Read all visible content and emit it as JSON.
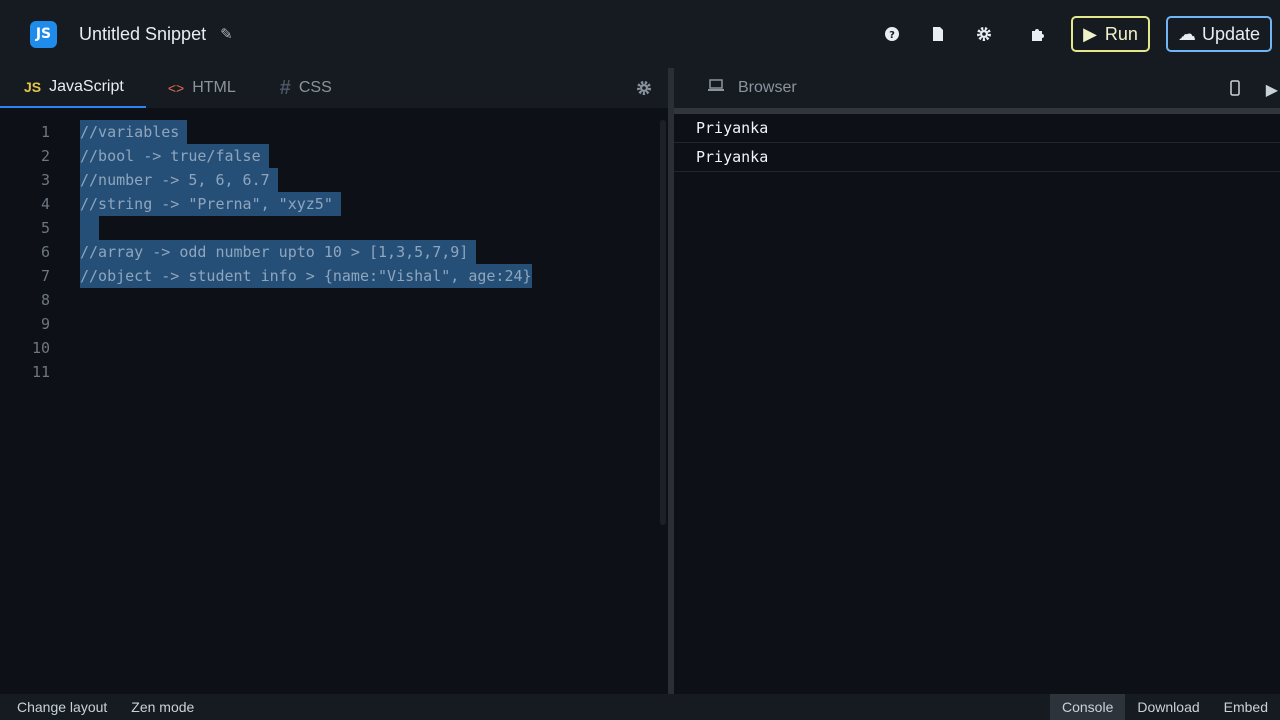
{
  "header": {
    "logo_text": "JS",
    "title": "Untitled Snippet",
    "run_label": "Run",
    "update_label": "Update"
  },
  "editor": {
    "tabs": [
      {
        "mark": "JS",
        "label": "JavaScript"
      },
      {
        "mark": "<>",
        "label": "HTML"
      },
      {
        "mark": "#",
        "label": "CSS"
      }
    ],
    "lines": [
      {
        "num": "1",
        "text": "//variables"
      },
      {
        "num": "2",
        "text": "//bool -> true/false"
      },
      {
        "num": "3",
        "text": "//number -> 5, 6, 6.7"
      },
      {
        "num": "4",
        "text": "//string -> \"Prerna\", \"xyz5\""
      },
      {
        "num": "5",
        "text": " "
      },
      {
        "num": "6",
        "text": "//array -> odd number upto 10 > [1,3,5,7,9]"
      },
      {
        "num": "7",
        "text": "//object -> student info > {name:\"Vishal\", age:24}"
      },
      {
        "num": "8",
        "text": ""
      },
      {
        "num": "9",
        "text": ""
      },
      {
        "num": "10",
        "text": ""
      },
      {
        "num": "11",
        "text": ""
      }
    ]
  },
  "browser": {
    "label": "Browser",
    "output": [
      "Priyanka",
      "Priyanka"
    ]
  },
  "footer": {
    "change_layout": "Change layout",
    "zen_mode": "Zen mode",
    "console": "Console",
    "download": "Download",
    "embed": "Embed"
  }
}
